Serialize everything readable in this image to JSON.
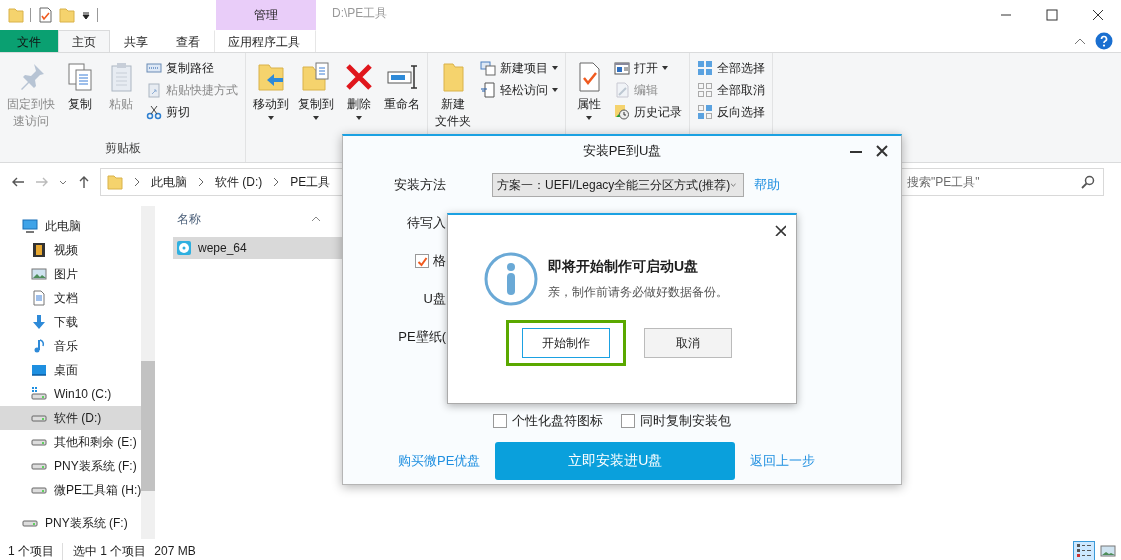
{
  "window": {
    "title": "D:\\PE工具",
    "context_tab": "管理"
  },
  "tabs": [
    {
      "label": "文件",
      "kind": "file",
      "selected": false
    },
    {
      "label": "主页",
      "kind": "tab",
      "selected": true
    },
    {
      "label": "共享",
      "kind": "tab",
      "selected": false
    },
    {
      "label": "查看",
      "kind": "tab",
      "selected": false
    },
    {
      "label": "应用程序工具",
      "kind": "context",
      "selected": false
    }
  ],
  "ribbon": {
    "groups": [
      {
        "label": "剪贴板",
        "large": [
          {
            "lines": [
              "固定到快",
              "速访问"
            ],
            "disabled": true,
            "dropdown": false
          },
          {
            "label": "复制",
            "disabled": false,
            "dropdown": false
          },
          {
            "label": "粘贴",
            "disabled": true,
            "dropdown": false
          }
        ],
        "small": [
          {
            "label": "复制路径",
            "disabled": false,
            "dropdown": false
          },
          {
            "label": "粘贴快捷方式",
            "disabled": true,
            "dropdown": false
          },
          {
            "label": "剪切",
            "disabled": false,
            "dropdown": false
          }
        ]
      },
      {
        "large": [
          {
            "label": "移动到",
            "disabled": false,
            "dropdown": true
          },
          {
            "label": "复制到",
            "disabled": false,
            "dropdown": true
          },
          {
            "label": "删除",
            "disabled": false,
            "dropdown": true
          },
          {
            "label": "重命名",
            "disabled": false,
            "dropdown": false
          }
        ]
      },
      {
        "large": [
          {
            "lines": [
              "新建",
              "文件夹"
            ],
            "disabled": false,
            "dropdown": false
          }
        ],
        "small": [
          {
            "label": "新建项目",
            "disabled": false,
            "dropdown": true
          },
          {
            "label": "轻松访问",
            "disabled": false,
            "dropdown": true
          }
        ]
      },
      {
        "large": [
          {
            "label": "属性",
            "disabled": false,
            "dropdown": true
          }
        ],
        "small": [
          {
            "label": "打开",
            "disabled": false,
            "dropdown": true
          },
          {
            "label": "编辑",
            "disabled": true,
            "dropdown": false
          },
          {
            "label": "历史记录",
            "disabled": false,
            "dropdown": false
          }
        ]
      },
      {
        "small": [
          {
            "label": "全部选择",
            "disabled": false,
            "dropdown": false
          },
          {
            "label": "全部取消",
            "disabled": false,
            "dropdown": false
          },
          {
            "label": "反向选择",
            "disabled": false,
            "dropdown": false
          }
        ]
      }
    ]
  },
  "address": {
    "crumbs": [
      "此电脑",
      "软件 (D:)",
      "PE工具"
    ]
  },
  "search": {
    "placeholder": "搜索\"PE工具\""
  },
  "tree": [
    {
      "label": "此电脑",
      "selected": false,
      "children": [
        {
          "label": "视频",
          "selected": false
        },
        {
          "label": "图片",
          "selected": false
        },
        {
          "label": "文档",
          "selected": false
        },
        {
          "label": "下载",
          "selected": false
        },
        {
          "label": "音乐",
          "selected": false
        },
        {
          "label": "桌面",
          "selected": false
        },
        {
          "label": "Win10 (C:)",
          "selected": false
        },
        {
          "label": "软件 (D:)",
          "selected": true
        },
        {
          "label": "其他和剩余 (E:)",
          "selected": false
        },
        {
          "label": "PNY装系统 (F:)",
          "selected": false
        },
        {
          "label": "微PE工具箱 (H:)",
          "selected": false
        }
      ]
    },
    {
      "label": "PNY装系统 (F:)",
      "selected": false
    }
  ],
  "files": {
    "column": "名称",
    "items": [
      {
        "name": "wepe_64",
        "selected": true
      }
    ]
  },
  "status_bar": {
    "count": "1 个项目",
    "selection": "选中 1 个项目",
    "size": "207 MB",
    "views": [
      {
        "selected": true
      },
      {
        "selected": false
      }
    ]
  },
  "installer": {
    "title": "安装PE到U盘",
    "method_label": "安装方法",
    "method_value": "方案一：UEFI/Legacy全能三分区方式(推荐)",
    "help_link": "帮助",
    "rows": [
      {
        "kind": "label",
        "label": "待写入"
      },
      {
        "kind": "checkbox",
        "label": "格",
        "checked": true
      },
      {
        "kind": "label",
        "label": "U盘"
      },
      {
        "kind": "label",
        "label": "PE壁纸("
      }
    ],
    "options": [
      {
        "label": "个性化盘符图标",
        "checked": false
      },
      {
        "label": "同时复制安装包",
        "checked": false
      }
    ],
    "buy_link": "购买微PE优盘",
    "install_button": "立即安装进U盘",
    "back_link": "返回上一步"
  },
  "confirm": {
    "title": "即将开始制作可启动U盘",
    "message": "亲，制作前请务必做好数据备份。",
    "buttons": [
      {
        "label": "开始制作",
        "kind": "primary",
        "highlighted": true
      },
      {
        "label": "取消",
        "kind": "secondary",
        "highlighted": false
      }
    ]
  }
}
